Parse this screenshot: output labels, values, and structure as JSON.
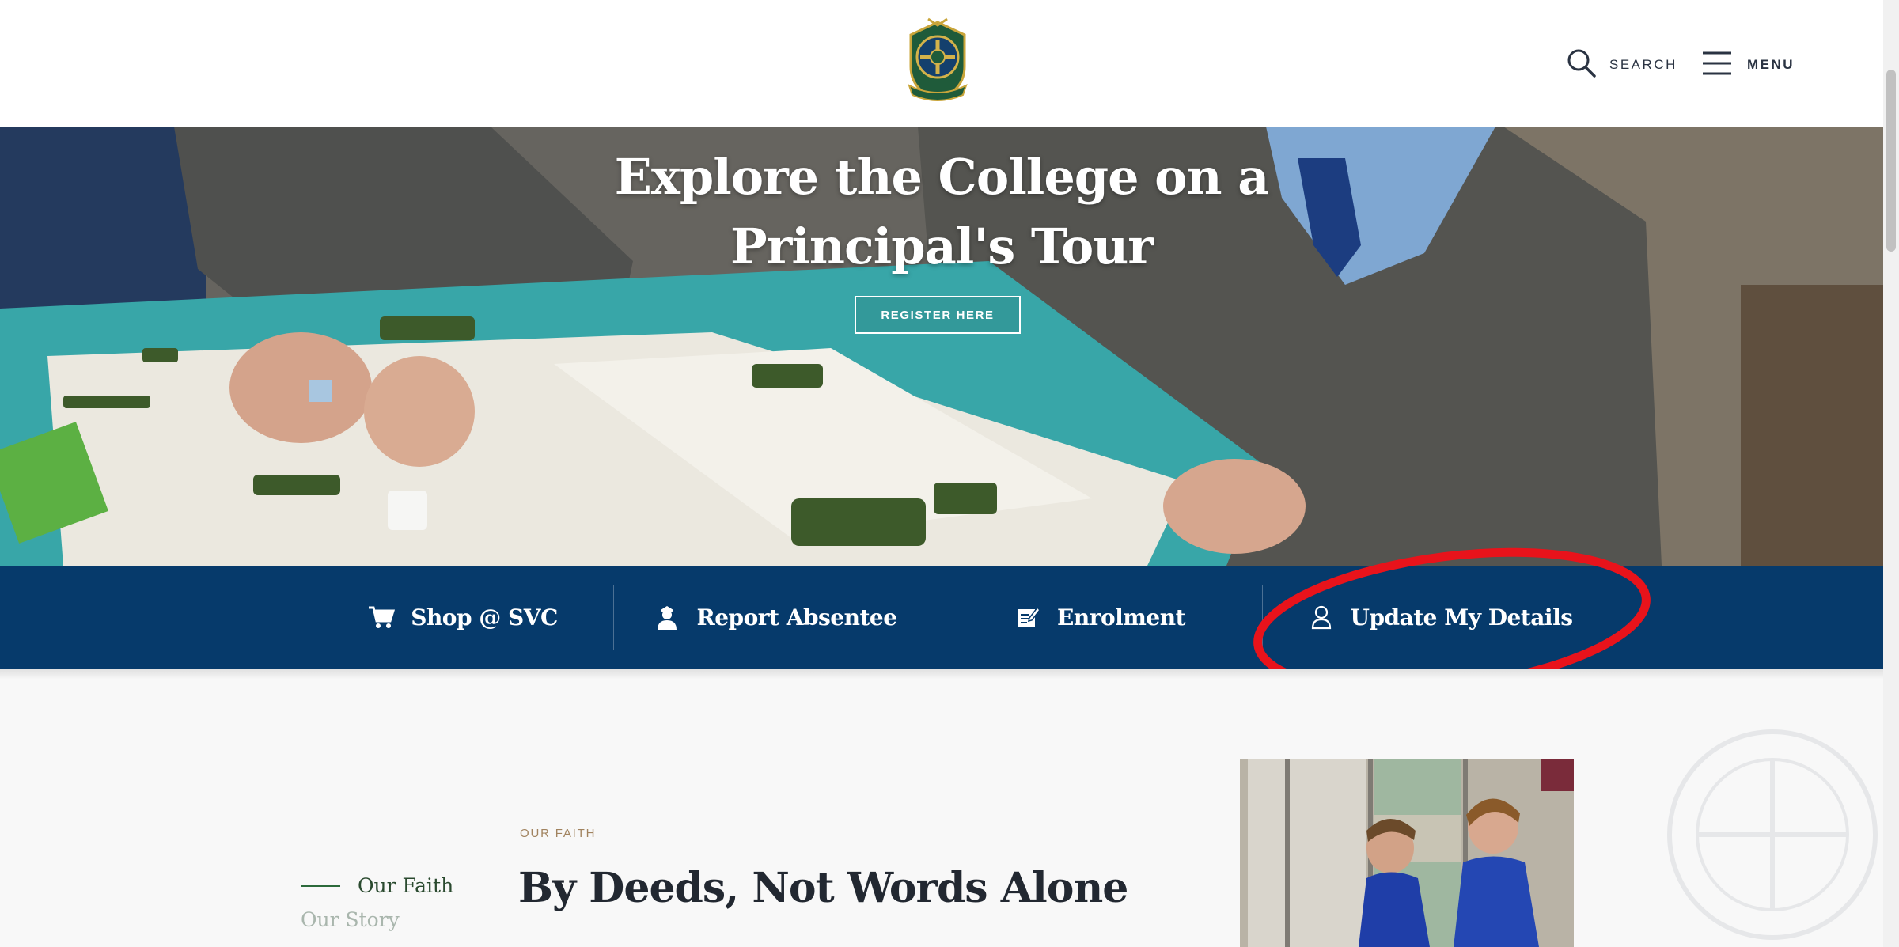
{
  "header": {
    "logo_name": "college-crest",
    "search_label": "SEARCH",
    "menu_label": "MENU"
  },
  "hero": {
    "title_line1": "Explore the College on a",
    "title_line2": "Principal's Tour",
    "button_label": "REGISTER HERE"
  },
  "quick_links": [
    {
      "label": "Shop @ SVC",
      "icon": "cart-icon"
    },
    {
      "label": "Report Absentee",
      "icon": "person-icon"
    },
    {
      "label": "Enrolment",
      "icon": "edit-form-icon"
    },
    {
      "label": "Update My Details",
      "icon": "user-outline-icon"
    }
  ],
  "content": {
    "subnav": [
      {
        "label": "Our Faith",
        "active": true
      },
      {
        "label": "Our Story",
        "active": false
      }
    ],
    "eyebrow": "OUR FAITH",
    "title": "By Deeds, Not Words Alone"
  },
  "colors": {
    "brand_navy": "#063a6b",
    "accent_green": "#2c6a3b",
    "annotation_red": "#e8131b",
    "eyebrow_gold": "#a1835f"
  }
}
